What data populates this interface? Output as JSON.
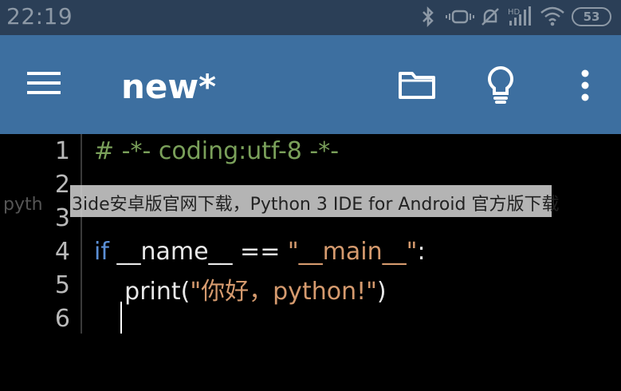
{
  "status_bar": {
    "time": "22:19",
    "battery": "53",
    "icons": [
      "bluetooth-icon",
      "vibrate-icon",
      "mute-icon",
      "hd-signal-icon",
      "wifi-icon",
      "battery-icon"
    ]
  },
  "app_bar": {
    "title": "new*",
    "icons": [
      "menu-icon",
      "folder-icon",
      "lightbulb-icon",
      "more-vert-icon"
    ],
    "background": "#3d6fa0"
  },
  "editor": {
    "line_numbers": [
      "1",
      "2",
      "3",
      "4",
      "5",
      "6"
    ],
    "line1_comment": "# -*- coding:utf-8 -*-",
    "line4_kw": "if",
    "line4_mid": " __name__ == ",
    "line4_str": "\"__main__\"",
    "line4_end": ":",
    "line5_pre": "    print(",
    "line5_str": "\"你好，python!\"",
    "line5_end": ")"
  },
  "overlay": {
    "left_fragment": "pyth",
    "text": "3ide安卓版官网下载，Python 3 IDE for Android 官方版下载"
  }
}
